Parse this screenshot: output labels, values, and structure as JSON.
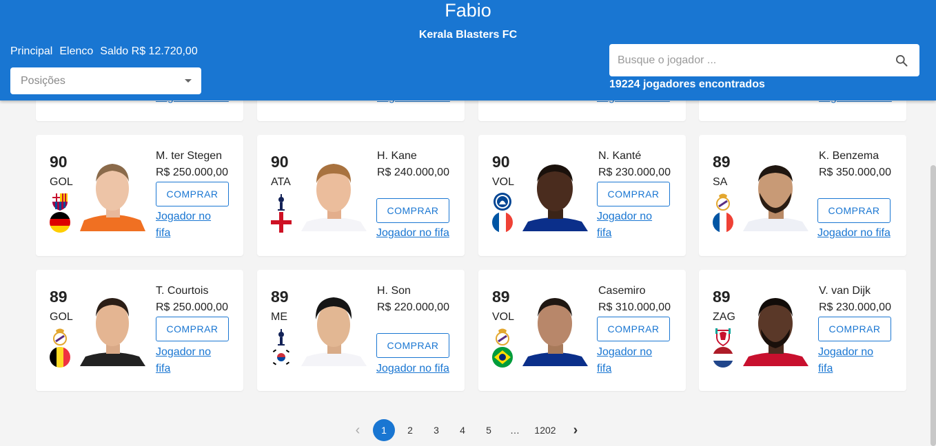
{
  "header": {
    "user": "Fabio",
    "team": "Kerala Blasters FC",
    "nav": {
      "principal": "Principal",
      "elenco": "Elenco",
      "saldo": "Saldo R$ 12.720,00"
    },
    "positions_placeholder": "Posições",
    "search_placeholder": "Busque o jogador ...",
    "found": "19224 jogadores encontrados"
  },
  "labels": {
    "buy": "COMPRAR",
    "fifa_link": "Jogador no fifa"
  },
  "colors": {
    "primary": "#1976d2"
  },
  "players": [
    {
      "ovr": "90",
      "pos": "GOL",
      "name": "M. ter Stegen",
      "price": "R$ 250.000,00",
      "club": "barcelona-crest-icon",
      "flag": "germany-flag-icon"
    },
    {
      "ovr": "90",
      "pos": "ATA",
      "name": "H. Kane",
      "price": "R$ 240.000,00",
      "club": "tottenham-crest-icon",
      "flag": "england-flag-icon"
    },
    {
      "ovr": "90",
      "pos": "VOL",
      "name": "N. Kanté",
      "price": "R$ 230.000,00",
      "club": "chelsea-crest-icon",
      "flag": "france-flag-icon"
    },
    {
      "ovr": "89",
      "pos": "SA",
      "name": "K. Benzema",
      "price": "R$ 350.000,00",
      "club": "real-madrid-crest-icon",
      "flag": "france-flag-icon"
    },
    {
      "ovr": "89",
      "pos": "GOL",
      "name": "T. Courtois",
      "price": "R$ 250.000,00",
      "club": "real-madrid-crest-icon",
      "flag": "belgium-flag-icon"
    },
    {
      "ovr": "89",
      "pos": "ME",
      "name": "H. Son",
      "price": "R$ 220.000,00",
      "club": "tottenham-crest-icon",
      "flag": "korea-flag-icon"
    },
    {
      "ovr": "89",
      "pos": "VOL",
      "name": "Casemiro",
      "price": "R$ 310.000,00",
      "club": "real-madrid-crest-icon",
      "flag": "brazil-flag-icon"
    },
    {
      "ovr": "89",
      "pos": "ZAG",
      "name": "V. van Dijk",
      "price": "R$ 230.000,00",
      "club": "liverpool-crest-icon",
      "flag": "netherlands-flag-icon"
    }
  ],
  "pagination": {
    "prev": "‹",
    "pages": [
      "1",
      "2",
      "3",
      "4",
      "5"
    ],
    "ellipsis": "…",
    "last": "1202",
    "next": "›",
    "current": "1"
  }
}
